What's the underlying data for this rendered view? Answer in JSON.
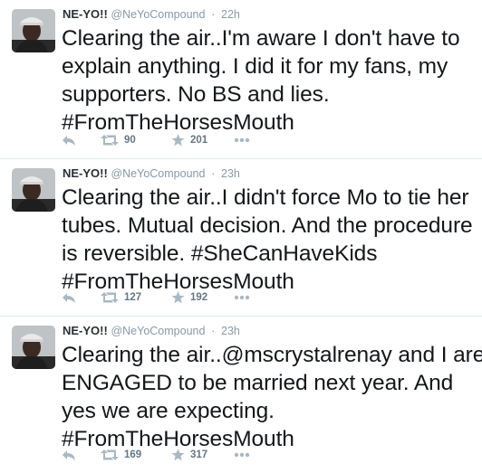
{
  "colors": {
    "text": "#14171a",
    "muted": "#8899a6",
    "action_icon": "#aab8c2",
    "divider": "#e1e8ed"
  },
  "tweets": [
    {
      "name": "NE-YO!!",
      "handle": "@NeYoCompound",
      "time": "22h",
      "lines": [
        "Clearing the air..I'm aware I don't have to",
        "explain anything. I did it for my fans, my",
        "supporters. No BS and lies.",
        "#FromTheHorsesMouth"
      ],
      "retweets": "90",
      "favorites": "201"
    },
    {
      "name": "NE-YO!!",
      "handle": "@NeYoCompound",
      "time": "23h",
      "lines": [
        "Clearing the air..I didn't force Mo to tie her",
        "tubes. Mutual decision. And the procedure",
        "is reversible. #SheCanHaveKids",
        "#FromTheHorsesMouth"
      ],
      "retweets": "127",
      "favorites": "192"
    },
    {
      "name": "NE-YO!!",
      "handle": "@NeYoCompound",
      "time": "23h",
      "lines": [
        "Clearing the air..@mscrystalrenay and I are",
        "ENGAGED to be married next year. And",
        "yes we are expecting.",
        "#FromTheHorsesMouth"
      ],
      "retweets": "169",
      "favorites": "317"
    }
  ],
  "icons": {
    "reply": "reply-icon",
    "retweet": "retweet-icon",
    "favorite": "star-icon",
    "more": "more-icon"
  }
}
